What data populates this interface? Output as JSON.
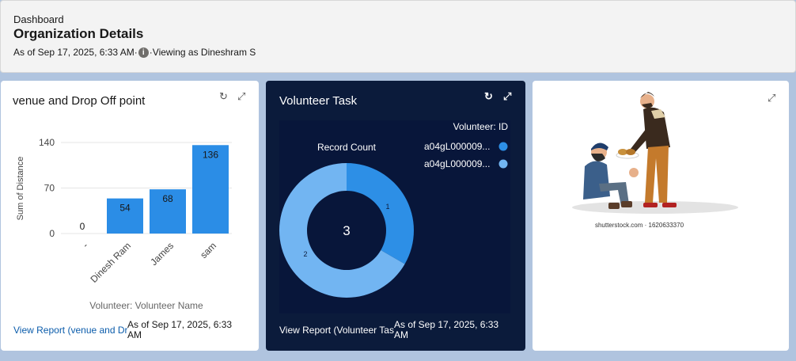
{
  "header": {
    "breadcrumb": "Dashboard",
    "title": "Organization Details",
    "as_of": "As of Sep 17, 2025, 6:33 AM·",
    "viewing_as": "·Viewing as Dineshram S"
  },
  "card1": {
    "title": "venue and Drop Off point",
    "footer_link": "View Report (venue and Dr",
    "footer_date": "As of Sep 17, 2025, 6:33 AM",
    "chart_data": {
      "type": "bar",
      "categories": [
        "-",
        "Dinesh Ram",
        "James",
        "sam"
      ],
      "values": [
        0,
        54,
        68,
        136
      ],
      "xlabel": "Volunteer: Volunteer Name",
      "ylabel": "Sum of Distance",
      "yticks": [
        0,
        70,
        140
      ],
      "ylim": [
        0,
        140
      ],
      "grid": true,
      "color": "#2b8de6"
    }
  },
  "card2": {
    "title": "Volunteer Task",
    "footer_link": "View Report (Volunteer Tas",
    "footer_date": "As of Sep 17, 2025, 6:33 AM",
    "chart_data": {
      "type": "pie",
      "subtitle": "Record Count",
      "center_label": "3",
      "legend_title": "Volunteer: ID",
      "legend_position": "top-right",
      "slices": [
        {
          "label": "a04gL000009...",
          "value": 1,
          "color": "#2d8fe6",
          "data_label": "1"
        },
        {
          "label": "a04gL000009...",
          "value": 2,
          "color": "#72b5f2",
          "data_label": "2"
        }
      ]
    }
  },
  "card3": {
    "watermark": "shutterstock.com · 1620633370"
  }
}
